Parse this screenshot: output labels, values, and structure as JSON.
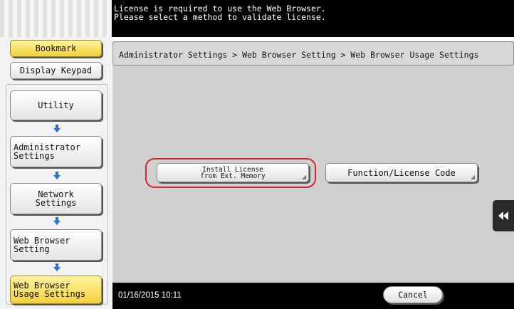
{
  "message": {
    "text": "License is required to use the Web Browser.\nPlease select a method to validate license."
  },
  "sidebar": {
    "bookmark_label": "Bookmark",
    "display_keypad_label": "Display Keypad",
    "path": [
      {
        "label": "Utility"
      },
      {
        "label": "Administrator\nSettings"
      },
      {
        "label": "Network\nSettings"
      },
      {
        "label": "Web Browser\nSetting"
      },
      {
        "label": "Web Browser\nUsage Settings"
      }
    ]
  },
  "main": {
    "breadcrumb": "Administrator Settings > Web Browser Setting > Web Browser Usage Settings",
    "install_license_label": "Install License\nfrom Ext. Memory",
    "function_license_label": "Function/License Code"
  },
  "bottom": {
    "datetime": "01/16/2015  10:11",
    "cancel_label": "Cancel"
  },
  "icons": {
    "side_tab": "double-left-arrow-icon",
    "arrow": "arrow-down-icon"
  },
  "colors": {
    "highlight": "#d8242a",
    "arrow": "#2a6fd8",
    "active_button": "#f2d23a"
  }
}
